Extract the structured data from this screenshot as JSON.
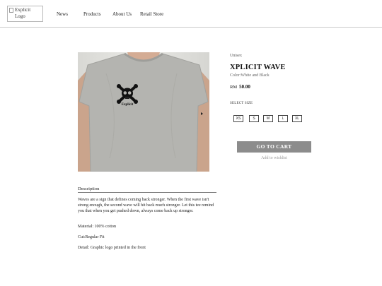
{
  "header": {
    "logo_alt": "Explicit Logo",
    "nav": [
      {
        "label": "News"
      },
      {
        "label": "Products"
      },
      {
        "label": "About Us"
      },
      {
        "label": "Retail Store"
      }
    ]
  },
  "product": {
    "image": {
      "print_text": "Explicit"
    },
    "category": "Unisex",
    "name": "XPLICIT WAVE",
    "color_line": "Color:White and Black",
    "currency": "RM",
    "price": "50.00",
    "size_label": "SELECT SIZE",
    "sizes": [
      "XS",
      "S",
      "M",
      "L",
      "XL"
    ],
    "cart_button": "GO TO CART",
    "wishlist_link": "Add to wishlist"
  },
  "description": {
    "heading": "Description",
    "text": "Waves are a sign that defines coming back stronger. When the first wave isn't strong enough, the second wave will hit back much stronger. Let this tee remind you that when you get pushed down, always come back up stronger.",
    "material": "Material: 100% cotton",
    "cut": "Cut:Regular Fit",
    "detail": "Detail: Graphic logo printed in the front"
  },
  "colors": {
    "cart_button": "#8c8c8c",
    "header_border": "#c9c9c9",
    "shirt": "#b4b4b0"
  }
}
